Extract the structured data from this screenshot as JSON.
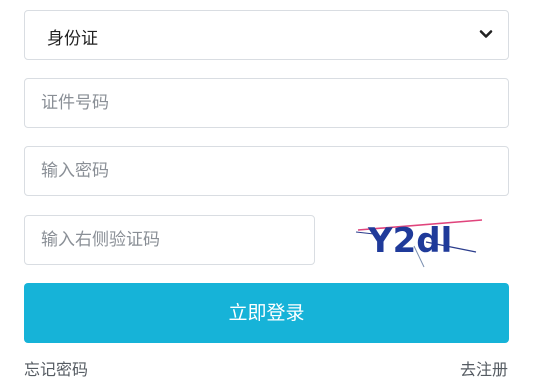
{
  "id_type_select": {
    "selected": "身份证",
    "icon": "chevron-down-icon"
  },
  "id_number": {
    "value": "",
    "placeholder": "证件号码"
  },
  "password": {
    "value": "",
    "placeholder": "输入密码"
  },
  "captcha": {
    "value": "",
    "placeholder": "输入右侧验证码",
    "image_text": "Y2dl"
  },
  "login_button": {
    "label": "立即登录"
  },
  "links": {
    "forgot_password": "忘记密码",
    "register": "去注册"
  },
  "colors": {
    "accent": "#16b3d8",
    "captcha_text": "#1f3a9a",
    "captcha_noise": "#e0447c"
  }
}
